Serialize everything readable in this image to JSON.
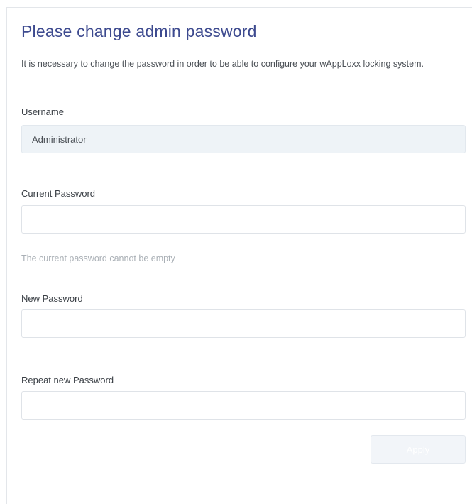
{
  "form": {
    "title": "Please change admin password",
    "description": "It is necessary to change the password in order to be able to configure your wAppLoxx locking system.",
    "username": {
      "label": "Username",
      "value": "Administrator"
    },
    "current_password": {
      "label": "Current Password",
      "value": "",
      "error": "The current password cannot be empty"
    },
    "new_password": {
      "label": "New Password",
      "value": ""
    },
    "repeat_password": {
      "label": "Repeat new Password",
      "value": ""
    },
    "apply_label": "Apply",
    "colors": {
      "title": "#3d4a8f",
      "readonly_field_bg": "#eef3f7",
      "hint_text": "#aab0b6",
      "apply_disabled_bg": "#f2f5f9"
    }
  }
}
